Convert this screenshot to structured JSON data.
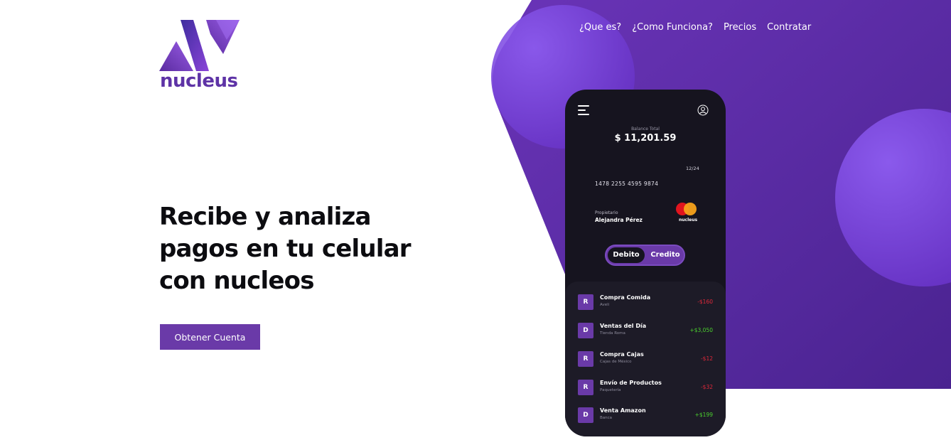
{
  "brand": {
    "name": "nucleus"
  },
  "nav": {
    "items": [
      "¿Que es?",
      "¿Como Funciona?",
      "Precios",
      "Contratar"
    ]
  },
  "hero": {
    "title_lines": [
      "Recibe y analiza",
      "pagos en tu celular",
      "con nucleos"
    ],
    "cta_label": "Obtener Cuenta"
  },
  "phone": {
    "balance_label": "Balance Total",
    "balance_value": "$ 11,201.59",
    "card": {
      "expiry": "12/24",
      "number": "1478 2255 4595 9874",
      "owner_label": "Propietario",
      "owner_name": "Alejandra Pérez",
      "brand": "nucleus"
    },
    "toggle": {
      "debit": "Debito",
      "credit": "Credito",
      "selected": "Debito"
    },
    "transactions": [
      {
        "badge": "R",
        "title": "Compra Comida",
        "subtitle": "Aveli",
        "amount": "-$160",
        "type": "negative"
      },
      {
        "badge": "D",
        "title": "Ventas del Día",
        "subtitle": "Tienda Roma",
        "amount": "+$3,050",
        "type": "positive"
      },
      {
        "badge": "R",
        "title": "Compra Cajas",
        "subtitle": "Cajas de México",
        "amount": "-$12",
        "type": "negative"
      },
      {
        "badge": "R",
        "title": "Envío de Productos",
        "subtitle": "Paquetería",
        "amount": "-$32",
        "type": "negative"
      },
      {
        "badge": "D",
        "title": "Venta Amazon",
        "subtitle": "Banca",
        "amount": "+$199",
        "type": "positive"
      }
    ]
  },
  "colors": {
    "accent": "#6a3aa8",
    "purple_bg": "#5a2ba0",
    "phone_bg": "#16141f",
    "negative": "#e0283a",
    "positive": "#4bd12e"
  }
}
